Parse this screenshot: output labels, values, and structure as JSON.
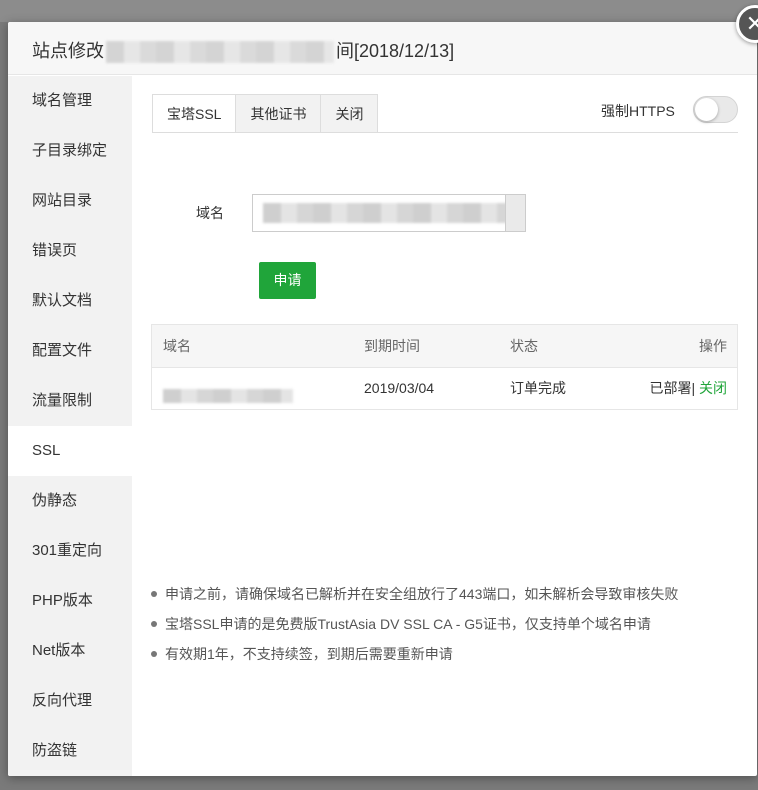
{
  "modal": {
    "title_prefix": "站点修改",
    "title_suffix": "间[2018/12/13]",
    "close_glyph": "✕"
  },
  "sidebar": {
    "items": [
      {
        "label": "域名管理"
      },
      {
        "label": "子目录绑定"
      },
      {
        "label": "网站目录"
      },
      {
        "label": "错误页"
      },
      {
        "label": "默认文档"
      },
      {
        "label": "配置文件"
      },
      {
        "label": "流量限制"
      },
      {
        "label": "SSL"
      },
      {
        "label": "伪静态"
      },
      {
        "label": "301重定向"
      },
      {
        "label": "PHP版本"
      },
      {
        "label": "Net版本"
      },
      {
        "label": "反向代理"
      },
      {
        "label": "防盗链"
      }
    ],
    "active_label": "SSL"
  },
  "tabs": [
    {
      "label": "宝塔SSL"
    },
    {
      "label": "其他证书"
    },
    {
      "label": "关闭"
    }
  ],
  "https_toggle": {
    "label": "强制HTTPS",
    "on": false
  },
  "domain_field": {
    "label": "域名"
  },
  "apply_button": {
    "label": "申请"
  },
  "colors": {
    "accent": "#20a53a"
  },
  "table": {
    "headers": {
      "domain": "域名",
      "expire": "到期时间",
      "status": "状态",
      "action": "操作"
    },
    "rows": [
      {
        "expire": "2019/03/04",
        "status": "订单完成",
        "deployed": "已部署",
        "separator": "|",
        "close": "关闭"
      }
    ]
  },
  "notes": [
    "申请之前，请确保域名已解析并在安全组放行了443端口，如未解析会导致审核失败",
    "宝塔SSL申请的是免费版TrustAsia DV SSL CA - G5证书，仅支持单个域名申请",
    "有效期1年，不支持续签，到期后需要重新申请"
  ]
}
